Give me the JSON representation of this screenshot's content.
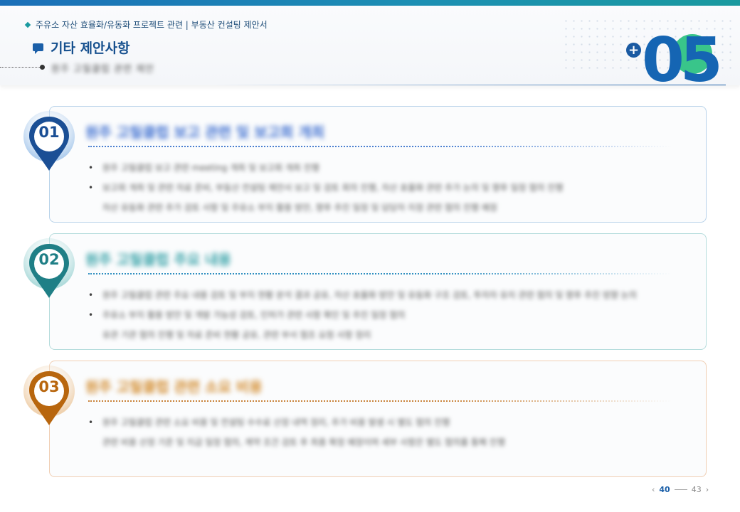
{
  "breadcrumb": "주유소 자산 효율화/유동화 프로젝트 관련 | 부동산 컨설팅 제안서",
  "page_title": "기타 제안사항",
  "subtitle": "원주 고릴클럽 관련 제안",
  "section_number": "05",
  "sections": [
    {
      "number": "01",
      "heading": "원주 고릴클럽 보고 관련 및 보고회 개최",
      "accent": "#1b4f95",
      "bullets": [
        {
          "lines": [
            "원주 고릴클럽 보고 관련 meeting 개최 및 보고회 개최 진행"
          ]
        },
        {
          "lines": [
            "보고회 개최 및 관련 자료 준비, 부동산 컨설팅 제안서 보고 및 검토 회의 진행, 자산 효율화 관련 추가 논의 및 향후 일정 협의 진행",
            "자산 유동화 관련 추가 검토 사항 및 주유소 부지 활용 방안, 향후 추진 일정 및 담당자 지정 관련 협의 진행 예정"
          ]
        }
      ]
    },
    {
      "number": "02",
      "heading": "원주 고릴클럽 주요 내용",
      "accent": "#1f7f86",
      "bullets": [
        {
          "lines": [
            "원주 고릴클럽 관련 주요 내용 검토 및 부지 현황 분석 결과 공유, 자산 효율화 방안 및 유동화 구조 검토, 투자자 유치 관련 협의 및 향후 추진 방향 논의"
          ]
        },
        {
          "lines": [
            "주유소 부지 활용 방안 및 개발 가능성 검토, 인허가 관련 사항 확인 및 추진 일정 협의",
            "유관 기관 협의 진행 및 자료 준비 현황 공유, 관련 부서 협조 요청 사항 정리"
          ]
        }
      ]
    },
    {
      "number": "03",
      "heading": "원주 고릴클럽 관련 소요 비용",
      "accent": "#b8660e",
      "bullets": [
        {
          "lines": [
            "원주 고릴클럽 관련 소요 비용 및 컨설팅 수수료 산정 내역 정리, 추가 비용 발생 시 별도 협의 진행",
            "관련 비용 산정 기준 및 지급 일정 협의, 계약 조건 검토 후 최종 확정 예정이며 세부 사항은 별도 협의를 통해 진행"
          ]
        }
      ]
    }
  ],
  "pager": {
    "current": "40",
    "total": "43",
    "prev_icon": "chevron-left-icon",
    "next_icon": "chevron-right-icon"
  }
}
